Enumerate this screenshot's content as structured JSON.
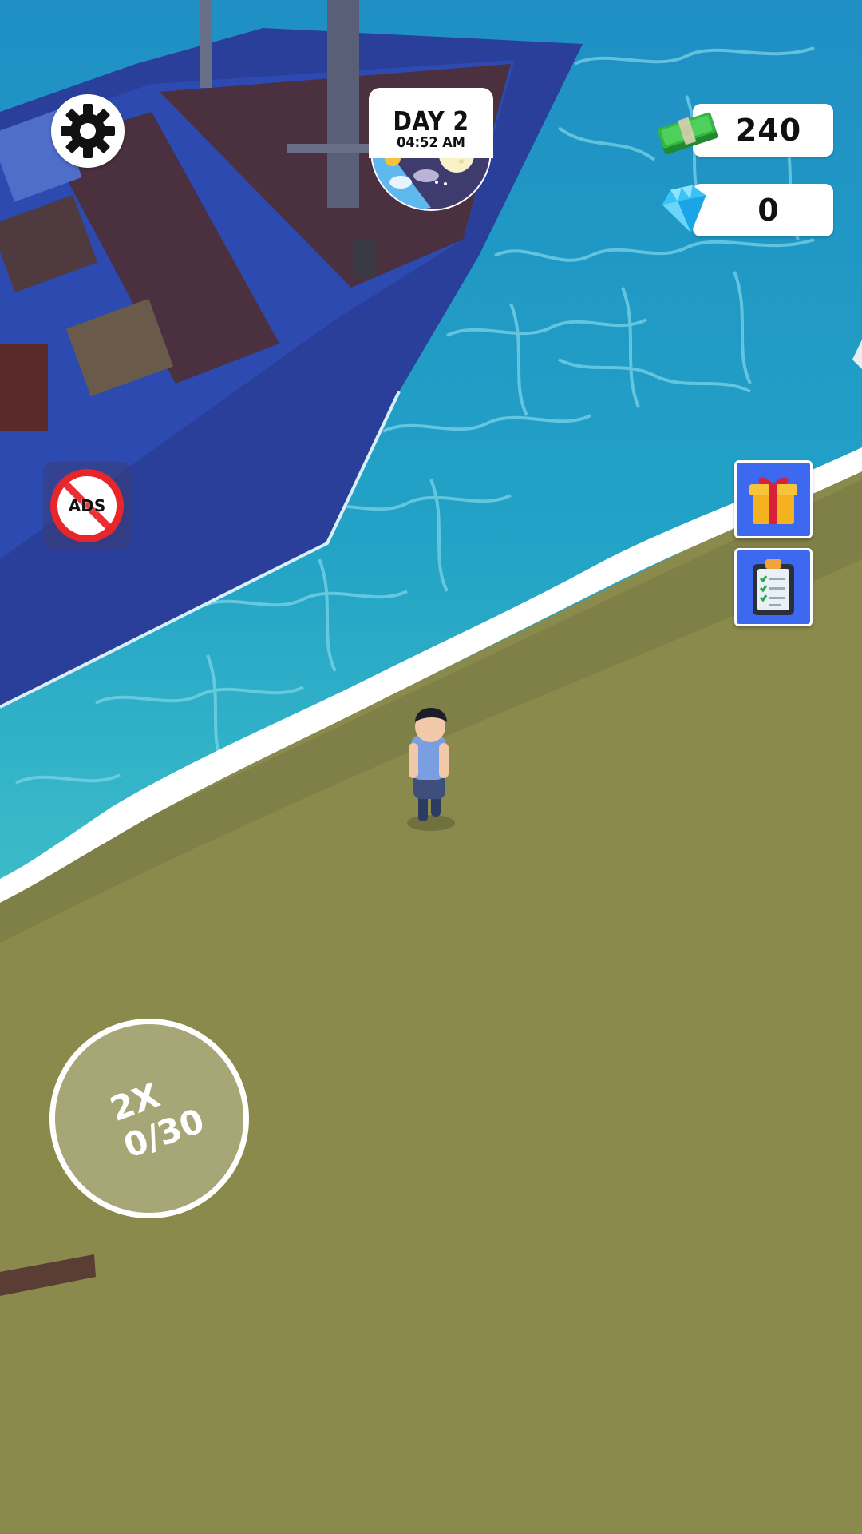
{
  "hud": {
    "day_label": "DAY 2",
    "time": "04:52 AM",
    "cash": "240",
    "gems": "0",
    "no_ads_label": "ADS",
    "boost_multiplier": "2X",
    "boost_progress": "0/30"
  },
  "icons": {
    "settings": "gear-icon",
    "cash": "cash-icon",
    "gems": "diamond-icon",
    "gift": "gift-icon",
    "tasks": "clipboard-icon",
    "no_ads": "no-ads-icon",
    "day_night": "day-night-icon"
  },
  "colors": {
    "sea": "#2aa6c6",
    "sand": "#8a8a4c",
    "ship_hull": "#2a3f9a",
    "button_blue": "#3d68f0",
    "no_ads_red": "#e8262a"
  }
}
